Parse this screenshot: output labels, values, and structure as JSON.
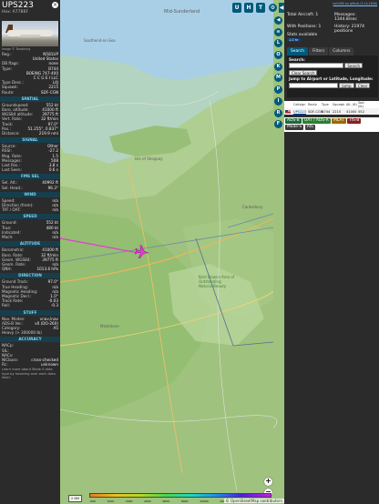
{
  "aircraft": {
    "callsign": "UPS223",
    "hex_line": "Hex: A77B6F",
    "photo_credit": "Image © Tarsaining",
    "details": [
      {
        "k": "Reg.:",
        "v": "N581UP"
      },
      {
        "k": "",
        "v": "United States"
      },
      {
        "k": "DB flags:",
        "v": "none"
      },
      {
        "k": "Type:",
        "v": "B744"
      },
      {
        "k": "",
        "v": "BOEING 747-400"
      },
      {
        "k": "",
        "v": "C C G E I LLC"
      },
      {
        "k": "Type Desc.:",
        "v": "L4J"
      },
      {
        "k": "Squawk:",
        "v": "2215"
      },
      {
        "k": "Route:",
        "v": "SDF-CGN"
      }
    ]
  },
  "sections": [
    {
      "title": "SPATIAL",
      "rows": [
        {
          "k": "Groundspeed:",
          "v": "552 kt"
        },
        {
          "k": "Baro. altitude:",
          "v": "41000 ft"
        },
        {
          "k": "WGS84 altitude:",
          "v": "39775 ft"
        },
        {
          "k": "Vert. Rate:",
          "v": "32 ft/min"
        },
        {
          "k": "Track:",
          "v": "97.0°"
        },
        {
          "k": "Pos.:",
          "v": "51.255°, 0.837°"
        },
        {
          "k": "Distance:",
          "v": "219.9 nmi"
        }
      ]
    },
    {
      "title": "SIGNAL",
      "rows": [
        {
          "k": "Source:",
          "v": "Other"
        },
        {
          "k": "RSSI:",
          "v": "-27.2"
        },
        {
          "k": "Msg. Rate:",
          "v": "1.5"
        },
        {
          "k": "Messages:",
          "v": "508"
        },
        {
          "k": "Last Pos.:",
          "v": "3.8 s"
        },
        {
          "k": "Last Seen:",
          "v": "0.6 s"
        }
      ]
    },
    {
      "title": "FMS SEL",
      "rows": [
        {
          "k": "Sel. Alt.:",
          "v": "40992 ft"
        },
        {
          "k": "Sel. Head.:",
          "v": "96.3°"
        }
      ]
    },
    {
      "title": "WIND",
      "rows": [
        {
          "k": "Speed:",
          "v": "n/a"
        },
        {
          "k": "Direction (from):",
          "v": "n/a"
        },
        {
          "k": "TAT / OAT:",
          "v": "n/a"
        }
      ]
    },
    {
      "title": "SPEED",
      "rows": [
        {
          "k": "Ground:",
          "v": "552 kt"
        },
        {
          "k": "True:",
          "v": "480 kt"
        },
        {
          "k": "Indicated:",
          "v": "n/a"
        },
        {
          "k": "Mach:",
          "v": "n/a"
        }
      ]
    },
    {
      "title": "ALTITUDE",
      "rows": [
        {
          "k": "Barometric:",
          "v": "41000 ft"
        },
        {
          "k": "Baro. Rate:",
          "v": "32 ft/min"
        },
        {
          "k": "Geom. WGS84:",
          "v": "39775 ft"
        },
        {
          "k": "Geom. Rate:",
          "v": "n/a"
        },
        {
          "k": "QNH:",
          "v": "1013.6 hPa"
        }
      ]
    },
    {
      "title": "DIRECTION",
      "rows": [
        {
          "k": "Ground Track:",
          "v": "97.0°"
        },
        {
          "k": "True Heading:",
          "v": "n/a"
        },
        {
          "k": "Magnetic Heading:",
          "v": "n/a"
        },
        {
          "k": "Magnetic Decl.:",
          "v": "1.0°"
        },
        {
          "k": "Track Rate:",
          "v": "-0.03"
        },
        {
          "k": "Roll:",
          "v": "-0.3"
        }
      ]
    },
    {
      "title": "STUFF",
      "rows": [
        {
          "k": "Nav. Modes:",
          "v": "vnav,lnav"
        },
        {
          "k": "ADS-B Ver.:",
          "v": "v0 (DO-260)"
        },
        {
          "k": "Category:",
          "v": "A5"
        },
        {
          "k": "Heavy (> 300000 lb)",
          "v": ""
        }
      ]
    },
    {
      "title": "ACCURACY",
      "rows": [
        {
          "k": "NACp:",
          "v": ""
        },
        {
          "k": "SIL:",
          "v": ""
        },
        {
          "k": "NACv:",
          "v": ""
        },
        {
          "k": "NICbaro:",
          "v": "cross-checked"
        },
        {
          "k": "Rc:",
          "v": "unknown"
        }
      ]
    }
  ],
  "footer_note": "Learn more about Mode S data type by hovering over each data label.",
  "toolbar": {
    "top_buttons": [
      "U",
      "H",
      "T"
    ],
    "side_buttons": [
      "L",
      "O",
      "K",
      "M",
      "P",
      "I",
      "R",
      "F"
    ]
  },
  "sidebar": {
    "link": "tar1090 on github (3.14.1606)",
    "total_aircraft_label": "Total Aircraft: 1",
    "messages_label": "Messages:",
    "messages_value": "1344.8/sec",
    "with_positions_label": "With Positions: 1",
    "history_label": "History: 21974 positions",
    "stats_label": "Stats available",
    "stats_badge": "1.0 hr",
    "tabs": [
      "Search",
      "Filters",
      "Columns"
    ],
    "search_label": "Search:",
    "search_button": "Search",
    "clear_search_button": "Clear Search",
    "jump_label": "Jump to Airport or Latitude, Longitude:",
    "jump_button": "Jump",
    "clear_button": "Clear",
    "table_headers": [
      "Callsign",
      "Route",
      "Type",
      "Squawk",
      "Alt. (ft)",
      "Spd. (kt)"
    ],
    "table_row": [
      "UPS223",
      "SDF-CGN",
      "B744",
      "2215",
      "41000",
      "552"
    ],
    "filter_chips": [
      {
        "label": "ADS-B",
        "color": "#1c6b3a"
      },
      {
        "label": "UAT / ADS-R",
        "color": "#2e7d32"
      },
      {
        "label": "MLAT",
        "color": "#9a6a00"
      },
      {
        "label": "TIS-B",
        "color": "#8a1f1f"
      },
      {
        "label": "Mode-S",
        "color": "#3b3b3b"
      },
      {
        "label": "AIS",
        "color": "#444"
      }
    ]
  },
  "map": {
    "labels": {
      "mid_sussex": "Mid-Sunderland",
      "southend": "Southend-on-Sea",
      "sheerness": "Isle of Sheppey",
      "canterbury": "Canterbury",
      "kent_downs": "Kent Downs Area of Outstanding Natural Beauty",
      "maidstone": "Maidstone"
    },
    "attribution": "© OpenStreetMap contributors.",
    "scale_label": "2 NM",
    "altitude_legend": [
      "-500",
      "1000",
      "2000",
      "4000",
      "6000",
      "8000",
      "10000",
      "20000",
      "30000",
      "40000+"
    ],
    "zoom_in": "+",
    "zoom_out": "−"
  }
}
